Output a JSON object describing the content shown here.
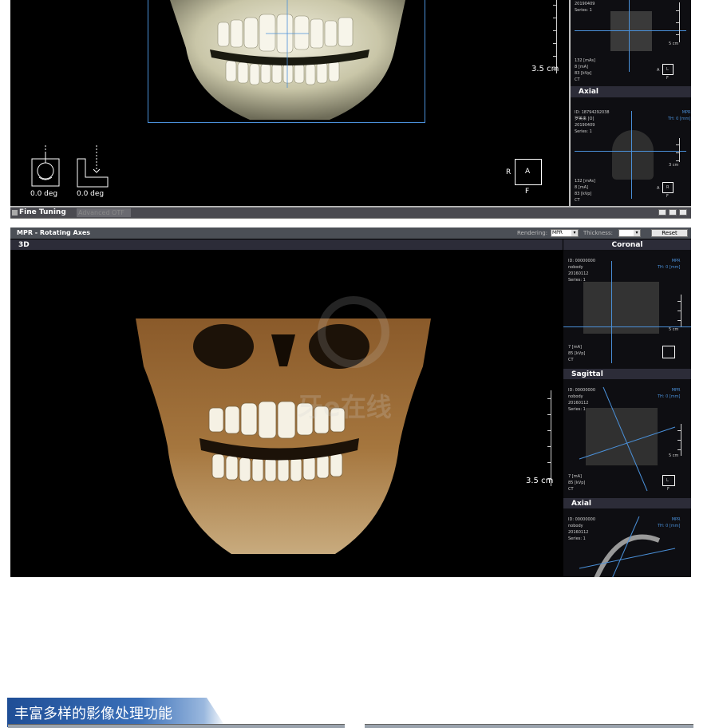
{
  "top_window": {
    "scale_label": "3.5 cm",
    "rotation_left": "0.0 deg",
    "rotation_right": "0.0 deg",
    "orientation": {
      "left": "R",
      "center": "A",
      "bottom": "F"
    },
    "fine_tuning": "Fine Tuning",
    "advanced_otf": "Advanced OTF",
    "thumb1": {
      "info": "20190409\nSeries: 1",
      "scale": "5 cm",
      "params": "132 [mAs]\n8 [mA]\n83 [kVp]\nCT",
      "orient_a": "A",
      "orient_l": "L",
      "orient_f": "F"
    },
    "axial_panel": {
      "title": "Axial",
      "info": "ID: 18794292038\n罗美来 [O]\n20190409\nSeries: 1",
      "mode": "MPR\nTH: 0 [mm]",
      "scale": "3 cm",
      "params": "132 [mAs]\n8 [mA]\n83 [kVp]\nCT",
      "orient_a": "A",
      "orient_r": "R",
      "orient_f": "F"
    }
  },
  "mpr_window": {
    "title": "MPR - Rotating Axes",
    "rendering_label": "Rendering:",
    "rendering_value": "MPR",
    "thickness_label": "Thickness:",
    "thickness_value": "",
    "reset_label": "Reset",
    "view_3d_label": "3D",
    "scale_label": "3.5 cm",
    "watermark": "牙e在线",
    "coronal": {
      "title": "Coronal",
      "info": "ID: 00000000\nnobody\n20160112\nSeries: 1",
      "mode": "MPR\nTH: 0 [mm]",
      "scale": "5 cm",
      "params": "7 [mA]\n85 [kVp]\nCT"
    },
    "sagittal": {
      "title": "Sagittal",
      "info": "ID: 00000000\nnobody\n20160112\nSeries: 1",
      "mode": "MPR\nTH: 0 [mm]",
      "scale": "5 cm",
      "params": "7 [mA]\n85 [kVp]\nCT",
      "orient_l": "L",
      "orient_f": "F"
    },
    "axial": {
      "title": "Axial",
      "info": "ID: 00000000\nnobody\n20160112\nSeries: 1",
      "mode": "MPR\nTH: 0 [mm]"
    }
  },
  "section_banner": {
    "title": "丰富多样的影像处理功能"
  },
  "colors": {
    "accent_blue": "#4a90d9",
    "banner_start": "#1f4e96",
    "dark_bg": "#000000",
    "panel_bg": "#2c2c38"
  },
  "icons": [
    "head-rotation-icon",
    "profile-rotation-icon",
    "orientation-cube-icon",
    "toolbar-icons"
  ]
}
